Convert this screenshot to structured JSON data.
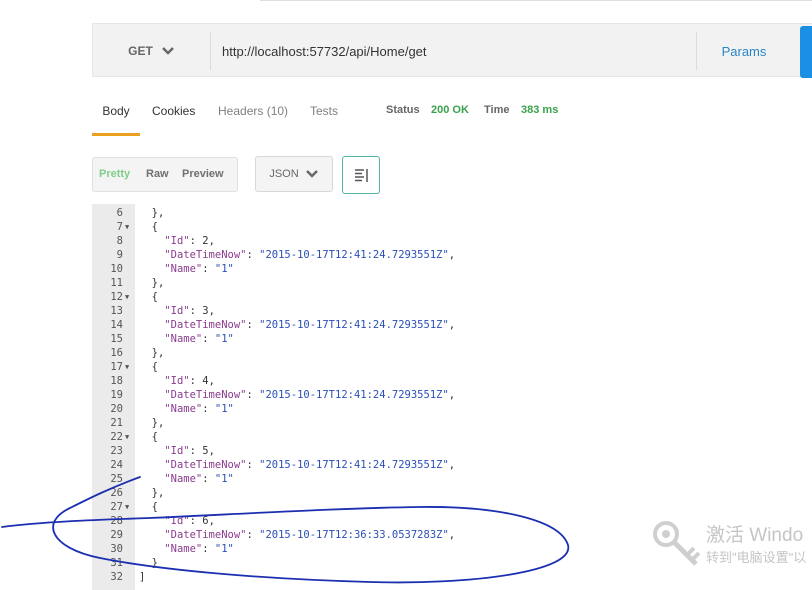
{
  "request": {
    "method": "GET",
    "url": "http://localhost:57732/api/Home/get",
    "params_label": "Params"
  },
  "response_tabs": [
    "Body",
    "Cookies",
    "Headers (10)",
    "Tests"
  ],
  "status": {
    "status_label": "Status",
    "status_value": "200 OK",
    "time_label": "Time",
    "time_value": "383 ms"
  },
  "view": {
    "modes": [
      "Pretty",
      "Raw",
      "Preview"
    ],
    "format": "JSON"
  },
  "code_lines": [
    {
      "n": "6",
      "fold": false,
      "text": "  },"
    },
    {
      "n": "7",
      "fold": true,
      "text": "  {"
    },
    {
      "n": "8",
      "fold": false,
      "key": "\"Id\"",
      "sep": ": ",
      "num": "2",
      "end": ","
    },
    {
      "n": "9",
      "fold": false,
      "key": "\"DateTimeNow\"",
      "sep": ": ",
      "str": "\"2015-10-17T12:41:24.7293551Z\"",
      "end": ","
    },
    {
      "n": "10",
      "fold": false,
      "key": "\"Name\"",
      "sep": ": ",
      "str": "\"1\"",
      "end": ""
    },
    {
      "n": "11",
      "fold": false,
      "text": "  },"
    },
    {
      "n": "12",
      "fold": true,
      "text": "  {"
    },
    {
      "n": "13",
      "fold": false,
      "key": "\"Id\"",
      "sep": ": ",
      "num": "3",
      "end": ","
    },
    {
      "n": "14",
      "fold": false,
      "key": "\"DateTimeNow\"",
      "sep": ": ",
      "str": "\"2015-10-17T12:41:24.7293551Z\"",
      "end": ","
    },
    {
      "n": "15",
      "fold": false,
      "key": "\"Name\"",
      "sep": ": ",
      "str": "\"1\"",
      "end": ""
    },
    {
      "n": "16",
      "fold": false,
      "text": "  },"
    },
    {
      "n": "17",
      "fold": true,
      "text": "  {"
    },
    {
      "n": "18",
      "fold": false,
      "key": "\"Id\"",
      "sep": ": ",
      "num": "4",
      "end": ","
    },
    {
      "n": "19",
      "fold": false,
      "key": "\"DateTimeNow\"",
      "sep": ": ",
      "str": "\"2015-10-17T12:41:24.7293551Z\"",
      "end": ","
    },
    {
      "n": "20",
      "fold": false,
      "key": "\"Name\"",
      "sep": ": ",
      "str": "\"1\"",
      "end": ""
    },
    {
      "n": "21",
      "fold": false,
      "text": "  },"
    },
    {
      "n": "22",
      "fold": true,
      "text": "  {"
    },
    {
      "n": "23",
      "fold": false,
      "key": "\"Id\"",
      "sep": ": ",
      "num": "5",
      "end": ","
    },
    {
      "n": "24",
      "fold": false,
      "key": "\"DateTimeNow\"",
      "sep": ": ",
      "str": "\"2015-10-17T12:41:24.7293551Z\"",
      "end": ","
    },
    {
      "n": "25",
      "fold": false,
      "key": "\"Name\"",
      "sep": ": ",
      "str": "\"1\"",
      "end": ""
    },
    {
      "n": "26",
      "fold": false,
      "text": "  },"
    },
    {
      "n": "27",
      "fold": true,
      "text": "  {"
    },
    {
      "n": "28",
      "fold": false,
      "key": "\"Id\"",
      "sep": ": ",
      "num": "6",
      "end": ","
    },
    {
      "n": "29",
      "fold": false,
      "key": "\"DateTimeNow\"",
      "sep": ": ",
      "str": "\"2015-10-17T12:36:33.0537283Z\"",
      "end": ","
    },
    {
      "n": "30",
      "fold": false,
      "key": "\"Name\"",
      "sep": ": ",
      "str": "\"1\"",
      "end": ""
    },
    {
      "n": "31",
      "fold": false,
      "text": "  }"
    },
    {
      "n": "32",
      "fold": false,
      "text": "]"
    }
  ],
  "watermark": {
    "title": "激活 Windo",
    "subtitle": "转到\"电脑设置\"以"
  },
  "colors": {
    "accent_tab": "#e8a01e",
    "status_ok": "#3aa14a",
    "params_link": "#2a86c8",
    "send_button": "#1a8fe3",
    "json_key": "#8a3b8f",
    "json_string": "#2b4fb8",
    "annotation_ink": "#1b2fb0"
  },
  "icons": {
    "method_dropdown": "chevron-down-icon",
    "format_dropdown": "chevron-down-icon",
    "wrap": "wrap-lines-icon",
    "watermark": "key-icon"
  }
}
